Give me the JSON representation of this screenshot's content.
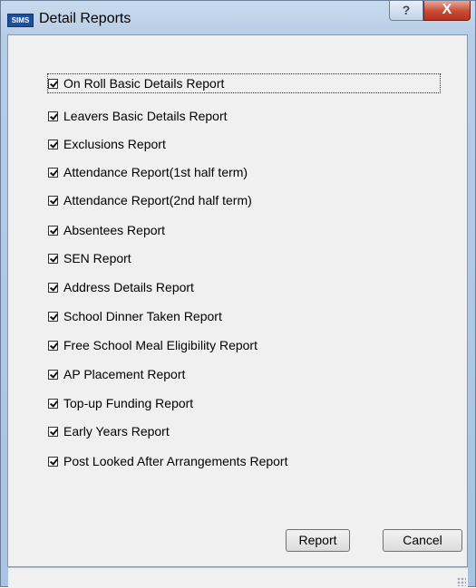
{
  "window": {
    "title": "Detail Reports",
    "app_icon_text": "SIMS",
    "help_glyph": "?",
    "close_glyph": "X"
  },
  "reports": [
    {
      "label": "On Roll Basic Details Report",
      "checked": true
    },
    {
      "label": "Leavers Basic Details Report",
      "checked": true
    },
    {
      "label": "Exclusions Report",
      "checked": true
    },
    {
      "label": "Attendance Report(1st half term)",
      "checked": true
    },
    {
      "label": "Attendance Report(2nd half term)",
      "checked": true
    },
    {
      "label": "Absentees Report",
      "checked": true
    },
    {
      "label": "SEN Report",
      "checked": true
    },
    {
      "label": "Address Details Report",
      "checked": true
    },
    {
      "label": "School Dinner Taken Report",
      "checked": true
    },
    {
      "label": "Free School Meal Eligibility Report",
      "checked": true
    },
    {
      "label": "AP Placement Report",
      "checked": true
    },
    {
      "label": "Top-up Funding Report",
      "checked": true
    },
    {
      "label": "Early Years Report",
      "checked": true
    },
    {
      "label": "Post Looked After Arrangements Report",
      "checked": true
    }
  ],
  "buttons": {
    "report": "Report",
    "cancel": "Cancel"
  }
}
